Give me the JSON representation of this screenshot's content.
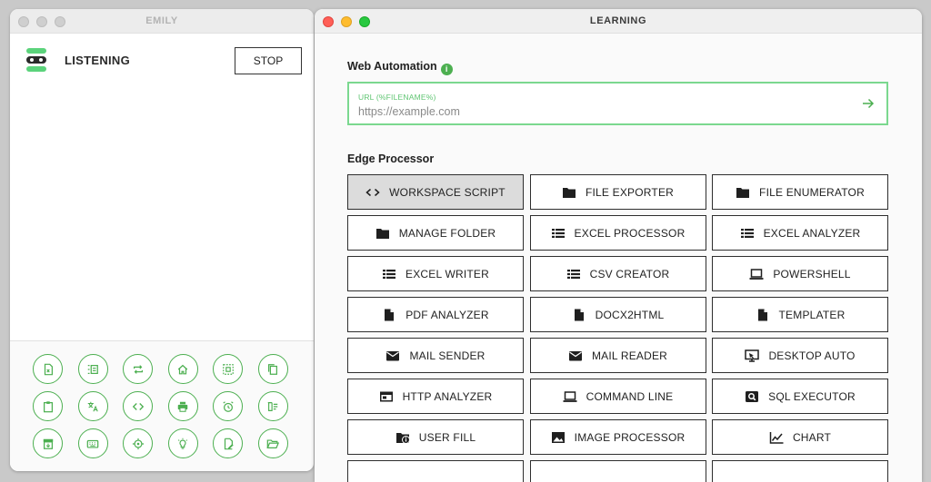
{
  "emily": {
    "title": "EMILY",
    "status": "LISTENING",
    "stop_label": "STOP",
    "tools": [
      {
        "icon": "excel-file-icon"
      },
      {
        "icon": "list-icon"
      },
      {
        "icon": "repeat-icon"
      },
      {
        "icon": "home-icon"
      },
      {
        "icon": "select-area-icon"
      },
      {
        "icon": "copy-icon"
      },
      {
        "icon": "clipboard-icon"
      },
      {
        "icon": "translate-icon"
      },
      {
        "icon": "code-icon"
      },
      {
        "icon": "print-icon"
      },
      {
        "icon": "alarm-icon"
      },
      {
        "icon": "delete-list-icon"
      },
      {
        "icon": "archive-icon"
      },
      {
        "icon": "keyboard-icon"
      },
      {
        "icon": "target-icon"
      },
      {
        "icon": "lightbulb-icon"
      },
      {
        "icon": "edit-file-icon"
      },
      {
        "icon": "open-folder-icon"
      }
    ]
  },
  "learning": {
    "title": "LEARNING",
    "web_automation": {
      "heading": "Web Automation",
      "url_label": "URL (%FILENAME%)",
      "url_placeholder": "https://example.com"
    },
    "edge_processor": {
      "heading": "Edge Processor",
      "items": [
        {
          "label": "WORKSPACE SCRIPT",
          "icon": "code-icon",
          "selected": true
        },
        {
          "label": "FILE EXPORTER",
          "icon": "folder-icon"
        },
        {
          "label": "FILE ENUMERATOR",
          "icon": "folder-icon"
        },
        {
          "label": "MANAGE FOLDER",
          "icon": "folder-icon"
        },
        {
          "label": "EXCEL PROCESSOR",
          "icon": "list-icon"
        },
        {
          "label": "EXCEL ANALYZER",
          "icon": "list-icon"
        },
        {
          "label": "EXCEL WRITER",
          "icon": "list-icon"
        },
        {
          "label": "CSV CREATOR",
          "icon": "list-icon"
        },
        {
          "label": "POWERSHELL",
          "icon": "laptop-icon"
        },
        {
          "label": "PDF ANALYZER",
          "icon": "document-icon"
        },
        {
          "label": "DOCX2HTML",
          "icon": "document-icon"
        },
        {
          "label": "TEMPLATER",
          "icon": "document-icon"
        },
        {
          "label": "MAIL SENDER",
          "icon": "mail-icon"
        },
        {
          "label": "MAIL READER",
          "icon": "mail-icon"
        },
        {
          "label": "DESKTOP AUTO",
          "icon": "desktop-icon"
        },
        {
          "label": "HTTP ANALYZER",
          "icon": "web-window-icon"
        },
        {
          "label": "COMMAND LINE",
          "icon": "laptop-icon"
        },
        {
          "label": "SQL EXECUTOR",
          "icon": "query-icon"
        },
        {
          "label": "USER FILL",
          "icon": "folder-info-icon"
        },
        {
          "label": "IMAGE PROCESSOR",
          "icon": "image-icon"
        },
        {
          "label": "CHART",
          "icon": "chart-icon"
        },
        {
          "label": "",
          "icon": "",
          "partial": true
        },
        {
          "label": "",
          "icon": "",
          "partial": true
        },
        {
          "label": "",
          "icon": "",
          "partial": true
        }
      ]
    }
  },
  "colors": {
    "accent_green": "#4caf50",
    "url_border": "#7bd88f",
    "selected_bg": "#dcdcdc"
  }
}
